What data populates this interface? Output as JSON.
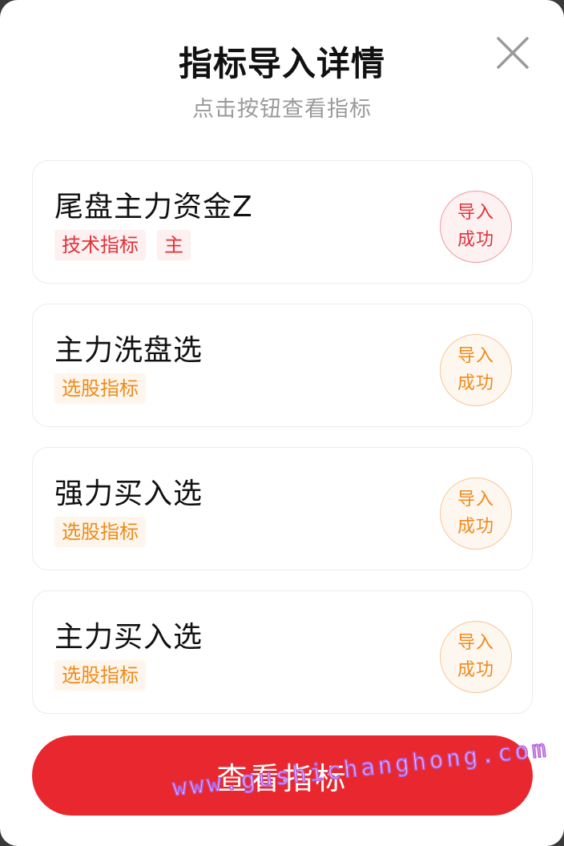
{
  "dialog": {
    "title": "指标导入详情",
    "subtitle": "点击按钮查看指标",
    "close_icon": "close-icon"
  },
  "indicators": [
    {
      "name": "尾盘主力资金Z",
      "tags": [
        "技术指标",
        "主"
      ],
      "tag_color": "red",
      "status_line1": "导入",
      "status_line2": "成功"
    },
    {
      "name": "主力洗盘选",
      "tags": [
        "选股指标"
      ],
      "tag_color": "orange",
      "status_line1": "导入",
      "status_line2": "成功"
    },
    {
      "name": "强力买入选",
      "tags": [
        "选股指标"
      ],
      "tag_color": "orange",
      "status_line1": "导入",
      "status_line2": "成功"
    },
    {
      "name": "主力买入选",
      "tags": [
        "选股指标"
      ],
      "tag_color": "orange",
      "status_line1": "导入",
      "status_line2": "成功"
    }
  ],
  "action_button": {
    "label": "查看指标"
  },
  "watermark": {
    "text": "www.gushichanghong.com"
  },
  "colors": {
    "primary_red": "#e8282e",
    "tag_red": "#e0333a",
    "tag_orange": "#ef8a1b",
    "title_text": "#111111",
    "subtitle_text": "#9a9a9a"
  }
}
